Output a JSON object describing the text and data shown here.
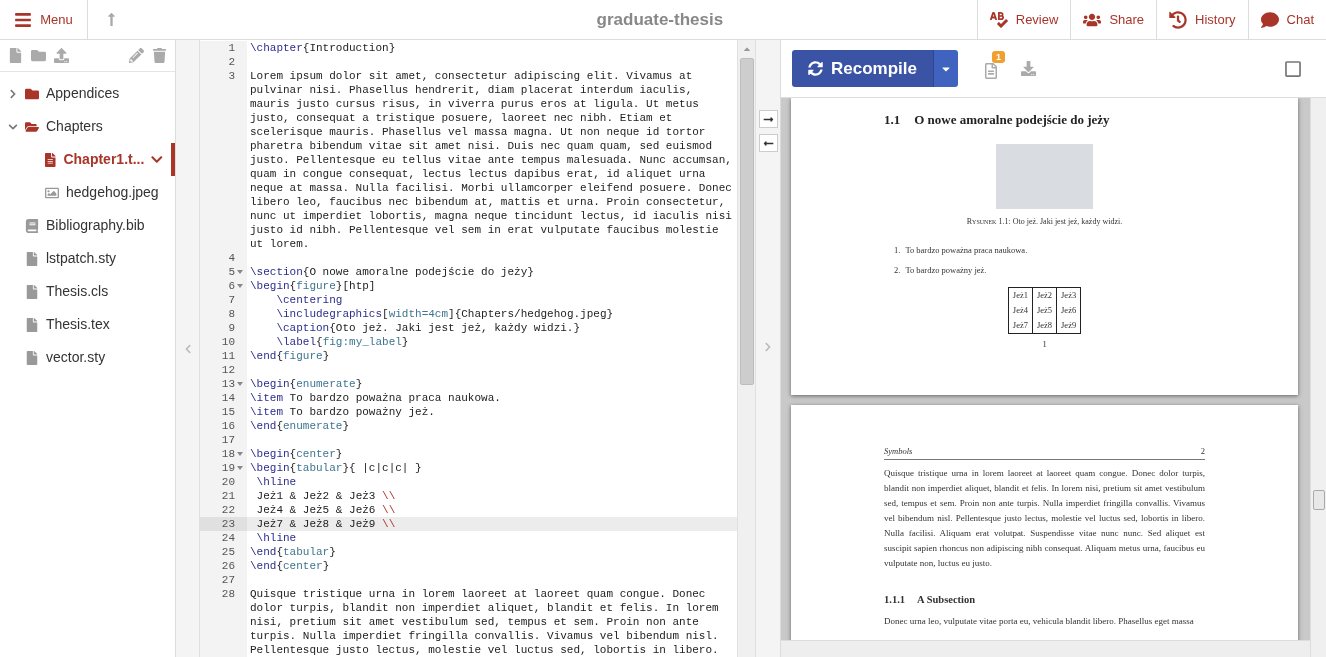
{
  "header": {
    "menu": "Menu",
    "title": "graduate-thesis",
    "actions": [
      {
        "kind": "review",
        "label": "Review"
      },
      {
        "kind": "share",
        "label": "Share"
      },
      {
        "kind": "history",
        "label": "History"
      },
      {
        "kind": "chat",
        "label": "Chat"
      }
    ]
  },
  "file_tree": [
    {
      "name": "Appendices",
      "kind": "folder",
      "expanded": false,
      "selected": false
    },
    {
      "name": "Chapters",
      "kind": "folder",
      "expanded": true,
      "selected": false,
      "children": [
        {
          "name": "Chapter1.t...",
          "kind": "tex",
          "selected": true
        },
        {
          "name": "hedgehog.jpeg",
          "kind": "image",
          "selected": false
        }
      ]
    },
    {
      "name": "Bibliography.bib",
      "kind": "bib",
      "selected": false
    },
    {
      "name": "lstpatch.sty",
      "kind": "file",
      "selected": false
    },
    {
      "name": "Thesis.cls",
      "kind": "file",
      "selected": false
    },
    {
      "name": "Thesis.tex",
      "kind": "file",
      "selected": false
    },
    {
      "name": "vector.sty",
      "kind": "file",
      "selected": false
    }
  ],
  "editor": {
    "lines": [
      {
        "n": "1",
        "fold": false,
        "current": false,
        "segments": [
          {
            "kind": "command",
            "text": "\\chapter"
          },
          {
            "kind": "plain",
            "text": "{Introduction}"
          }
        ]
      },
      {
        "n": "2",
        "fold": false,
        "current": false
      },
      {
        "n": "3",
        "fold": false,
        "current": false,
        "segments": [
          {
            "kind": "plain",
            "text": "Lorem ipsum dolor sit amet, consectetur adipiscing elit. Vivamus at pulvinar nisi. Phasellus hendrerit, diam placerat interdum iaculis, mauris justo cursus risus, in viverra purus eros at ligula. Ut metus justo, consequat a tristique posuere, laoreet nec nibh. Etiam et scelerisque mauris. Phasellus vel massa magna. Ut non neque id tortor pharetra bibendum vitae sit amet nisi. Duis nec quam quam, sed euismod justo. Pellentesque eu tellus vitae ante tempus malesuada. Nunc accumsan, quam in congue consequat, lectus lectus dapibus erat, id aliquet urna neque at massa. Nulla facilisi. Morbi ullamcorper eleifend posuere. Donec libero leo, faucibus nec bibendum at, mattis et urna. Proin consectetur, nunc ut imperdiet lobortis, magna neque tincidunt lectus, id iaculis nisi justo id nibh. Pellentesque vel sem in erat vulputate faucibus molestie ut lorem."
          }
        ]
      },
      {
        "n": "4",
        "fold": false,
        "current": false
      },
      {
        "n": "5",
        "fold": true,
        "current": false,
        "segments": [
          {
            "kind": "command",
            "text": "\\section"
          },
          {
            "kind": "plain",
            "text": "{O nowe amoralne podejście do jeży}"
          }
        ]
      },
      {
        "n": "6",
        "fold": true,
        "current": false,
        "segments": [
          {
            "kind": "command",
            "text": "\\begin"
          },
          {
            "kind": "plain",
            "text": "{"
          },
          {
            "kind": "argument",
            "text": "figure"
          },
          {
            "kind": "plain",
            "text": "}[htp]"
          }
        ]
      },
      {
        "n": "7",
        "fold": false,
        "current": false,
        "segments": [
          {
            "kind": "command",
            "text": "    \\centering"
          }
        ]
      },
      {
        "n": "8",
        "fold": false,
        "current": false,
        "segments": [
          {
            "kind": "command",
            "text": "    \\includegraphics"
          },
          {
            "kind": "plain",
            "text": "["
          },
          {
            "kind": "argument",
            "text": "width=4cm"
          },
          {
            "kind": "plain",
            "text": "]{Chapters/hedgehog.jpeg}"
          }
        ]
      },
      {
        "n": "9",
        "fold": false,
        "current": false,
        "segments": [
          {
            "kind": "command",
            "text": "    \\caption"
          },
          {
            "kind": "plain",
            "text": "{Oto jeż. Jaki jest jeż, każdy widzi.}"
          }
        ]
      },
      {
        "n": "10",
        "fold": false,
        "current": false,
        "segments": [
          {
            "kind": "command",
            "text": "    \\label"
          },
          {
            "kind": "plain",
            "text": "{"
          },
          {
            "kind": "argument",
            "text": "fig:my_label"
          },
          {
            "kind": "plain",
            "text": "}"
          }
        ]
      },
      {
        "n": "11",
        "fold": false,
        "current": false,
        "segments": [
          {
            "kind": "command",
            "text": "\\end"
          },
          {
            "kind": "plain",
            "text": "{"
          },
          {
            "kind": "argument",
            "text": "figure"
          },
          {
            "kind": "plain",
            "text": "}"
          }
        ]
      },
      {
        "n": "12",
        "fold": false,
        "current": false
      },
      {
        "n": "13",
        "fold": true,
        "current": false,
        "segments": [
          {
            "kind": "command",
            "text": "\\begin"
          },
          {
            "kind": "plain",
            "text": "{"
          },
          {
            "kind": "argument",
            "text": "enumerate"
          },
          {
            "kind": "plain",
            "text": "}"
          }
        ]
      },
      {
        "n": "14",
        "fold": false,
        "current": false,
        "segments": [
          {
            "kind": "command",
            "text": "\\item"
          },
          {
            "kind": "plain",
            "text": " To bardzo poważna praca naukowa."
          }
        ]
      },
      {
        "n": "15",
        "fold": false,
        "current": false,
        "segments": [
          {
            "kind": "command",
            "text": "\\item"
          },
          {
            "kind": "plain",
            "text": " To bardzo poważny jeż."
          }
        ]
      },
      {
        "n": "16",
        "fold": false,
        "current": false,
        "segments": [
          {
            "kind": "command",
            "text": "\\end"
          },
          {
            "kind": "plain",
            "text": "{"
          },
          {
            "kind": "argument",
            "text": "enumerate"
          },
          {
            "kind": "plain",
            "text": "}"
          }
        ]
      },
      {
        "n": "17",
        "fold": false,
        "current": false
      },
      {
        "n": "18",
        "fold": true,
        "current": false,
        "segments": [
          {
            "kind": "command",
            "text": "\\begin"
          },
          {
            "kind": "plain",
            "text": "{"
          },
          {
            "kind": "argument",
            "text": "center"
          },
          {
            "kind": "plain",
            "text": "}"
          }
        ]
      },
      {
        "n": "19",
        "fold": true,
        "current": false,
        "segments": [
          {
            "kind": "command",
            "text": "\\begin"
          },
          {
            "kind": "plain",
            "text": "{"
          },
          {
            "kind": "argument",
            "text": "tabular"
          },
          {
            "kind": "plain",
            "text": "}{ |c|c|c| }"
          }
        ]
      },
      {
        "n": "20",
        "fold": false,
        "current": false,
        "segments": [
          {
            "kind": "command",
            "text": " \\hline"
          }
        ]
      },
      {
        "n": "21",
        "fold": false,
        "current": false,
        "segments": [
          {
            "kind": "plain",
            "text": " Jeż1 & Jeż2 & Jeż3 "
          },
          {
            "kind": "break",
            "text": "\\\\"
          }
        ]
      },
      {
        "n": "22",
        "fold": false,
        "current": false,
        "segments": [
          {
            "kind": "plain",
            "text": " Jeż4 & Jeż5 & Jeż6 "
          },
          {
            "kind": "break",
            "text": "\\\\"
          }
        ]
      },
      {
        "n": "23",
        "fold": false,
        "current": true,
        "segments": [
          {
            "kind": "plain",
            "text": " Jeż7 & Jeż8 & Jeż9 "
          },
          {
            "kind": "break",
            "text": "\\\\"
          }
        ]
      },
      {
        "n": "24",
        "fold": false,
        "current": false,
        "segments": [
          {
            "kind": "command",
            "text": " \\hline"
          }
        ]
      },
      {
        "n": "25",
        "fold": false,
        "current": false,
        "segments": [
          {
            "kind": "command",
            "text": "\\end"
          },
          {
            "kind": "plain",
            "text": "{"
          },
          {
            "kind": "argument",
            "text": "tabular"
          },
          {
            "kind": "plain",
            "text": "}"
          }
        ]
      },
      {
        "n": "26",
        "fold": false,
        "current": false,
        "segments": [
          {
            "kind": "command",
            "text": "\\end"
          },
          {
            "kind": "plain",
            "text": "{"
          },
          {
            "kind": "argument",
            "text": "center"
          },
          {
            "kind": "plain",
            "text": "}"
          }
        ]
      },
      {
        "n": "27",
        "fold": false,
        "current": false
      },
      {
        "n": "28",
        "fold": false,
        "current": false,
        "segments": [
          {
            "kind": "plain",
            "text": "Quisque tristique urna in lorem laoreet at laoreet quam congue. Donec dolor turpis, blandit non imperdiet aliquet, blandit et felis. In lorem nisi, pretium sit amet vestibulum sed, tempus et sem. Proin non ante turpis. Nulla imperdiet fringilla convallis. Vivamus vel bibendum nisl. Pellentesque justo lectus, molestie vel luctus sed, lobortis in libero."
          }
        ]
      }
    ]
  },
  "pdf": {
    "recompile": "Recompile",
    "log_badge": "1",
    "pages": [
      {
        "blocks": [
          {
            "kind": "section",
            "number": "1.1",
            "text": "O nowe amoralne podejście do jeży"
          },
          {
            "kind": "figure",
            "caption_label": "Rysunek",
            "caption": "1.1: Oto jeż. Jaki jest jeż, każdy widzi."
          },
          {
            "kind": "list",
            "items": [
              {
                "number": "1.",
                "text": "To bardzo poważna praca naukowa."
              },
              {
                "number": "2.",
                "text": "To bardzo poważny jeż."
              }
            ]
          },
          {
            "kind": "table",
            "rows": [
              [
                "Jeż1",
                "Jeż2",
                "Jeż3"
              ],
              [
                "Jeż4",
                "Jeż5",
                "Jeż6"
              ],
              [
                "Jeż7",
                "Jeż8",
                "Jeż9"
              ]
            ]
          },
          {
            "kind": "page_number",
            "text": "1"
          }
        ]
      },
      {
        "blocks": [
          {
            "kind": "running_head",
            "text": "Symbols",
            "number": "2"
          },
          {
            "kind": "paragraph",
            "text": "Quisque tristique urna in lorem laoreet at laoreet quam congue.  Donec dolor turpis, blandit non imperdiet aliquet, blandit et felis. In lorem nisi, pretium sit amet vestibulum sed, tempus et sem. Proin non ante turpis. Nulla imperdiet fringilla convallis. Vivamus vel bibendum nisl. Pellentesque justo lectus, molestie vel luctus sed, lobortis in libero. Nulla facilisi. Aliquam erat volutpat. Suspendisse vitae nunc nunc. Sed aliquet est suscipit sapien rhoncus non adipiscing nibh consequat. Aliquam metus urna, faucibus eu vulputate non, luctus eu justo."
          },
          {
            "kind": "subsection",
            "number": "1.1.1",
            "text": "A Subsection"
          },
          {
            "kind": "paragraph",
            "text": "Donec urna leo, vulputate vitae porta eu, vehicula blandit libero. Phasellus eget massa"
          }
        ]
      }
    ]
  }
}
